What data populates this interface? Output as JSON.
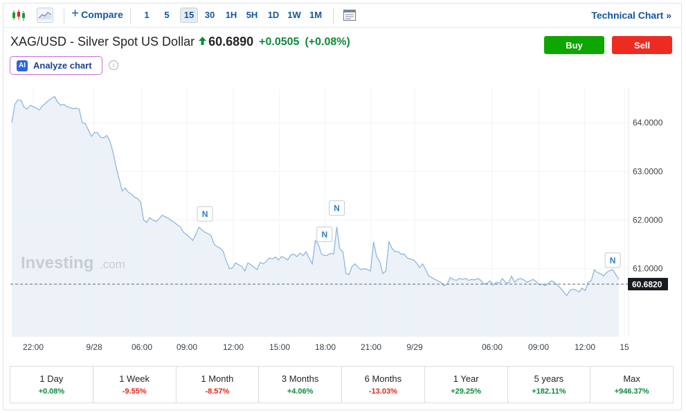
{
  "toolbar": {
    "compare_label": "Compare",
    "timeframes": [
      "1",
      "5",
      "15",
      "30",
      "1H",
      "5H",
      "1D",
      "1W",
      "1M"
    ],
    "active_timeframe": "15",
    "technical_chart_label": "Technical Chart »"
  },
  "instrument": {
    "name": "XAG/USD - Silver Spot US Dollar",
    "price": "60.6890",
    "change": "+0.0505",
    "change_pct": "(+0.08%)",
    "direction": "up"
  },
  "buttons": {
    "buy": "Buy",
    "sell": "Sell"
  },
  "analyze_label": "Analyze chart",
  "analyze_icon": "AI",
  "info_icon": "i",
  "watermark": {
    "brand": "Investing",
    "suffix": ".com"
  },
  "colors": {
    "line": "#8fb7de",
    "area": "#e9f0f7",
    "up": "#0d8a3a",
    "down": "#e0261a",
    "buy": "#0ea600",
    "sell": "#ee2b21",
    "link": "#1256a0"
  },
  "chart_data": {
    "type": "area",
    "ylim": [
      59.6,
      64.7
    ],
    "y_ticks": [
      {
        "value": 64.0,
        "label": "64.0000"
      },
      {
        "value": 63.0,
        "label": "63.0000"
      },
      {
        "value": 62.0,
        "label": "62.0000"
      },
      {
        "value": 61.0,
        "label": "61.0000"
      }
    ],
    "x_ticks": [
      "22:00",
      "9/28",
      "06:00",
      "09:00",
      "12:00",
      "15:00",
      "18:00",
      "21:00",
      "9/29",
      "06:00",
      "09:00",
      "12:00",
      "15"
    ],
    "current_price": {
      "value": 60.682,
      "label": "60.6820"
    },
    "news_marker_label": "N",
    "news_markers": [
      {
        "x": 63,
        "value": 61.92
      },
      {
        "x": 102,
        "value": 61.5
      },
      {
        "x": 106,
        "value": 62.04
      },
      {
        "x": 196,
        "value": 60.97
      }
    ],
    "x": [
      0,
      1,
      2,
      3,
      4,
      5,
      6,
      7,
      8,
      9,
      10,
      11,
      12,
      13,
      14,
      15,
      16,
      17,
      18,
      19,
      20,
      21,
      22,
      23,
      24,
      25,
      26,
      27,
      28,
      29,
      30,
      31,
      32,
      33,
      34,
      35,
      36,
      37,
      38,
      39,
      40,
      41,
      42,
      43,
      44,
      45,
      46,
      47,
      48,
      49,
      50,
      51,
      52,
      53,
      54,
      55,
      56,
      57,
      58,
      59,
      60,
      61,
      62,
      63,
      64,
      65,
      66,
      67,
      68,
      69,
      70,
      71,
      72,
      73,
      74,
      75,
      76,
      77,
      78,
      79,
      80,
      81,
      82,
      83,
      84,
      85,
      86,
      87,
      88,
      89,
      90,
      91,
      92,
      93,
      94,
      95,
      96,
      97,
      98,
      99,
      100,
      101,
      102,
      103,
      104,
      105,
      106,
      107,
      108,
      109,
      110,
      111,
      112,
      113,
      114,
      115,
      116,
      117,
      118,
      119,
      120,
      121,
      122,
      123,
      124,
      125,
      126,
      127,
      128,
      129,
      130,
      131,
      132,
      133,
      134,
      135,
      136,
      137,
      138,
      139,
      140,
      141,
      142,
      143,
      144,
      145,
      146,
      147,
      148,
      149,
      150,
      151,
      152,
      153,
      154,
      155,
      156,
      157,
      158,
      159,
      160,
      161,
      162,
      163,
      164,
      165,
      166,
      167,
      168,
      169,
      170,
      171,
      172,
      173,
      174,
      175,
      176,
      177,
      178,
      179,
      180,
      181,
      182,
      183,
      184,
      185,
      186,
      187,
      188,
      189,
      190,
      191,
      192,
      193,
      194,
      195,
      196,
      197,
      198
    ],
    "values": [
      64.0,
      64.38,
      64.47,
      64.46,
      64.32,
      64.28,
      64.36,
      64.33,
      64.3,
      64.26,
      64.35,
      64.4,
      64.46,
      64.5,
      64.54,
      64.42,
      64.36,
      64.38,
      64.33,
      64.31,
      64.29,
      64.3,
      64.28,
      64.0,
      63.98,
      63.85,
      63.72,
      63.8,
      63.79,
      63.7,
      63.69,
      63.74,
      63.62,
      63.4,
      63.1,
      62.85,
      62.6,
      62.66,
      62.57,
      62.54,
      62.47,
      62.44,
      62.38,
      62.0,
      61.95,
      62.05,
      62.0,
      61.97,
      62.02,
      62.1,
      62.07,
      62.04,
      61.99,
      61.95,
      61.9,
      61.86,
      61.75,
      61.7,
      61.65,
      61.58,
      61.7,
      61.85,
      61.8,
      61.75,
      61.72,
      61.68,
      61.5,
      61.45,
      61.42,
      61.35,
      61.15,
      61.0,
      61.02,
      61.12,
      61.08,
      61.05,
      60.95,
      61.12,
      61.08,
      61.03,
      60.98,
      61.13,
      61.1,
      61.15,
      61.22,
      61.2,
      61.24,
      61.18,
      61.25,
      61.22,
      61.18,
      61.28,
      61.3,
      61.25,
      61.32,
      61.27,
      61.35,
      61.22,
      61.1,
      61.58,
      61.5,
      61.3,
      61.27,
      61.28,
      61.32,
      61.3,
      61.86,
      61.4,
      61.35,
      60.9,
      60.88,
      61.05,
      61.1,
      61.02,
      60.98,
      61.0,
      60.98,
      60.95,
      61.55,
      61.25,
      61.15,
      60.9,
      60.95,
      61.55,
      61.42,
      61.35,
      61.35,
      61.3,
      61.3,
      61.22,
      61.2,
      61.18,
      61.12,
      61.02,
      61.1,
      60.98,
      60.85,
      60.82,
      60.78,
      60.75,
      60.72,
      60.65,
      60.68,
      60.82,
      60.78,
      60.76,
      60.8,
      60.78,
      60.8,
      60.76,
      60.78,
      60.77,
      60.8,
      60.76,
      60.68,
      60.7,
      60.75,
      60.66,
      60.72,
      60.7,
      60.8,
      60.72,
      60.7,
      60.85,
      60.72,
      60.78,
      60.8,
      60.77,
      60.72,
      60.75,
      60.78,
      60.74,
      60.67,
      60.68,
      60.65,
      60.7,
      60.75,
      60.72,
      60.66,
      60.6,
      60.52,
      60.45,
      60.55,
      60.58,
      60.56,
      60.52,
      60.6,
      60.55,
      60.72,
      60.75,
      60.98,
      60.92,
      60.9,
      60.85,
      60.92,
      60.96,
      60.98,
      60.88,
      60.78,
      60.7,
      60.69,
      60.71,
      60.7,
      60.69,
      60.7
    ]
  },
  "performance": [
    {
      "label": "1 Day",
      "value": "+0.08%",
      "dir": "up"
    },
    {
      "label": "1 Week",
      "value": "-9.55%",
      "dir": "down"
    },
    {
      "label": "1 Month",
      "value": "-8.57%",
      "dir": "down"
    },
    {
      "label": "3 Months",
      "value": "+4.06%",
      "dir": "up"
    },
    {
      "label": "6 Months",
      "value": "-13.03%",
      "dir": "down"
    },
    {
      "label": "1 Year",
      "value": "+29.25%",
      "dir": "up"
    },
    {
      "label": "5 years",
      "value": "+182.11%",
      "dir": "up"
    },
    {
      "label": "Max",
      "value": "+946.37%",
      "dir": "up"
    }
  ]
}
